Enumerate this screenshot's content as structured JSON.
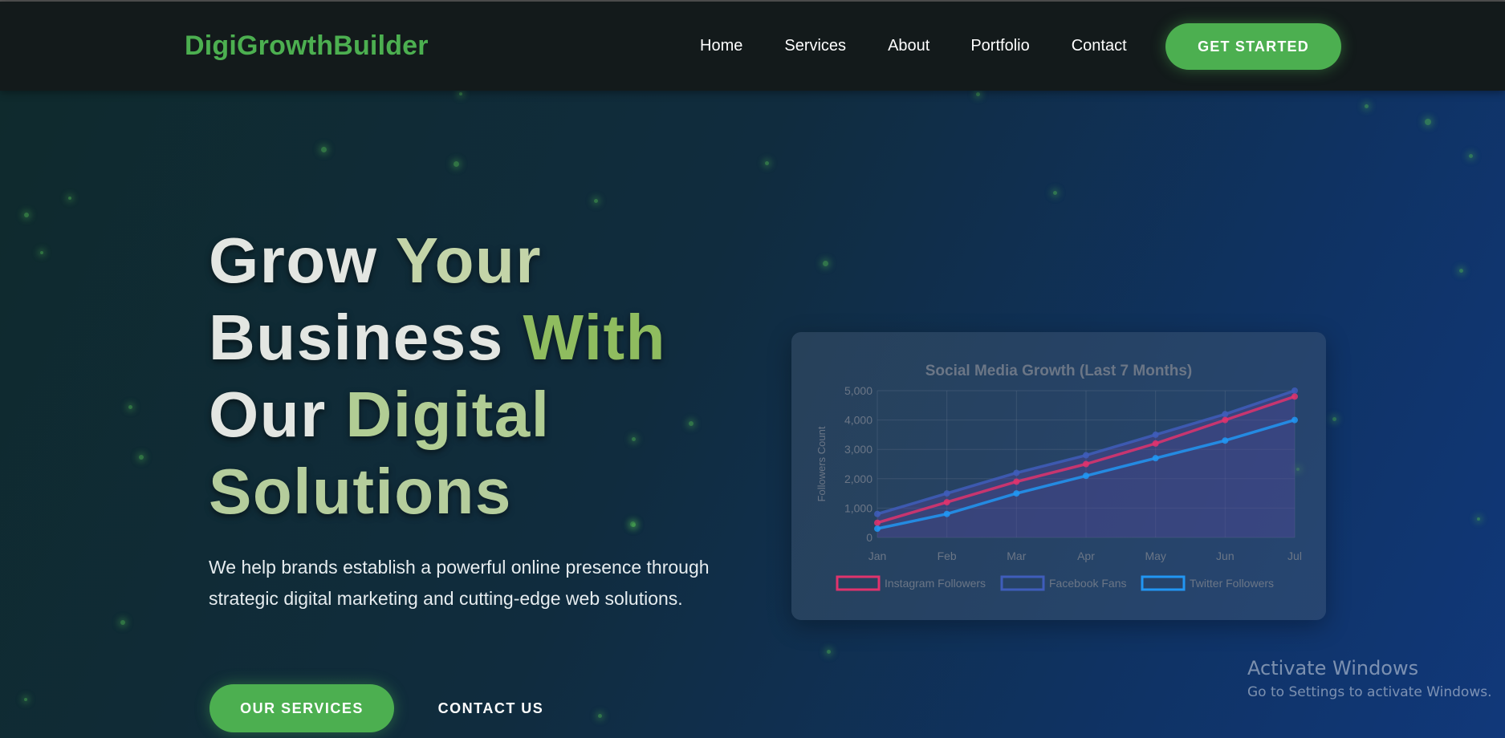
{
  "brand": {
    "logo": "DigiGrowthBuilder"
  },
  "nav": {
    "items": [
      "Home",
      "Services",
      "About",
      "Portfolio",
      "Contact"
    ],
    "cta": "GET STARTED"
  },
  "hero": {
    "title_lines": [
      [
        "Grow",
        "Your"
      ],
      [
        "Business",
        "With"
      ],
      [
        "Our",
        "Digital"
      ],
      [
        "Solutions"
      ]
    ],
    "description": "We help brands establish a powerful online presence through strategic digital marketing and cutting-edge web solutions.",
    "primary_button": "OUR SERVICES",
    "secondary_button": "CONTACT US"
  },
  "colors": {
    "accent": "#4caf50",
    "instagram": "#e0336d",
    "facebook": "#3f5dbb",
    "twitter": "#2196f3"
  },
  "chart_data": {
    "type": "line",
    "title": "Social Media Growth (Last 7 Months)",
    "xlabel": "",
    "ylabel": "Followers Count",
    "categories": [
      "Jan",
      "Feb",
      "Mar",
      "Apr",
      "May",
      "Jun",
      "Jul"
    ],
    "ylim": [
      0,
      5000
    ],
    "yticks": [
      0,
      1000,
      2000,
      3000,
      4000,
      5000
    ],
    "ytick_labels": [
      "0",
      "1,000",
      "2,000",
      "3,000",
      "4,000",
      "5,000"
    ],
    "grid": true,
    "legend": "bottom",
    "series": [
      {
        "name": "Instagram Followers",
        "values": [
          500,
          1200,
          1900,
          2500,
          3200,
          4000,
          4800
        ],
        "color": "#e0336d"
      },
      {
        "name": "Facebook Fans",
        "values": [
          800,
          1500,
          2200,
          2800,
          3500,
          4200,
          5000
        ],
        "color": "#3f5dbb"
      },
      {
        "name": "Twitter Followers",
        "values": [
          300,
          800,
          1500,
          2100,
          2700,
          3300,
          4000
        ],
        "color": "#2196f3"
      }
    ]
  },
  "system": {
    "activate_title": "Activate Windows",
    "activate_sub": "Go to Settings to activate Windows."
  }
}
